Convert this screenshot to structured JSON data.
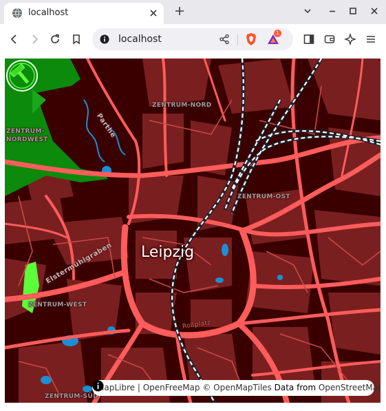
{
  "browser": {
    "tab": {
      "title": "localhost"
    },
    "address_bar": {
      "url": "localhost"
    },
    "rewards_badge": "1"
  },
  "map": {
    "city_label": "Leipzig",
    "district_labels": {
      "zentrum_nord": "ZENTRUM-NORD",
      "zentrum_nordwest_line1": "ZENTRUM-",
      "zentrum_nordwest_line2": "NORDWEST",
      "zentrum_ost": "ZENTRUM-OST",
      "zentrum_west": "ZENTRUM-WEST",
      "zentrum_sued": "ZENTRUM-SÜD"
    },
    "water_labels": {
      "parthe": "Parthe",
      "elstermuehlgraben": "Elstermühlgraben"
    },
    "street_labels": {
      "roßplatz": "Roßplatz"
    },
    "poi_icon": "hammer-icon",
    "colors": {
      "background": "#3a0000",
      "block": "#7a1f1f",
      "road": "#ff5c5c",
      "park": "#0b8a0b",
      "water": "#1a8fd6",
      "rail": "#ffffff"
    }
  },
  "attribution": {
    "maplibre": "MapLibre",
    "separator": " | ",
    "openfreemap": "OpenFreeMap",
    "copyright": " © ",
    "openmaptiles": "OpenMapTiles",
    "data_from": " Data from ",
    "osm": "OpenStreetMap"
  }
}
